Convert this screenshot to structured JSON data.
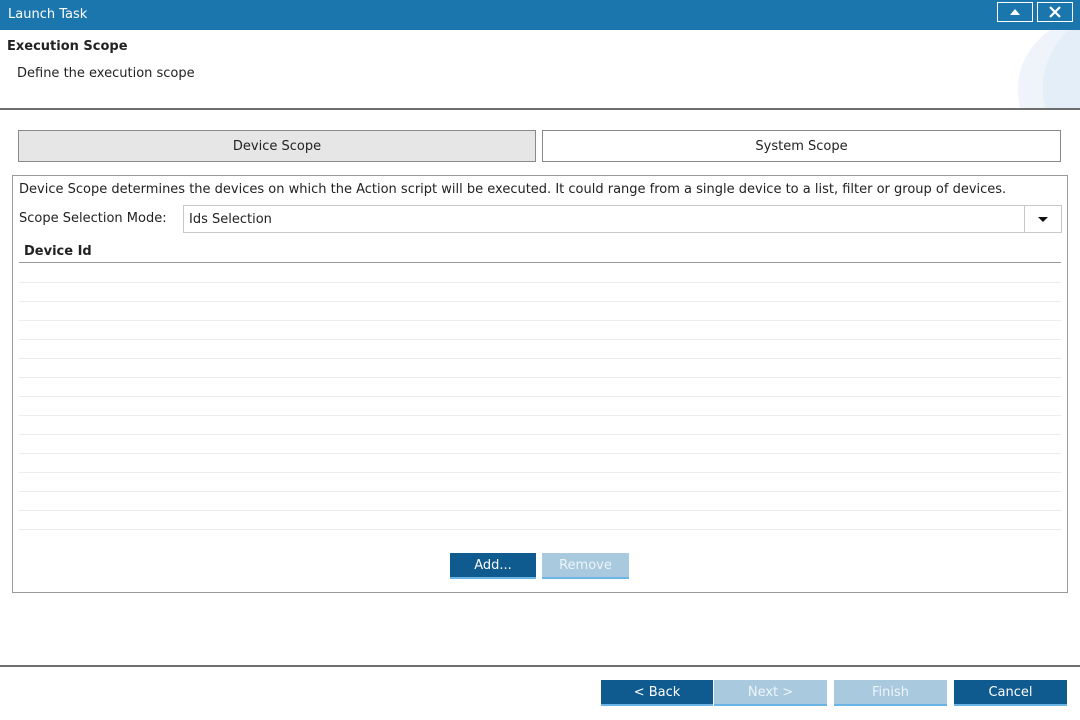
{
  "window": {
    "title": "Launch Task"
  },
  "header": {
    "title": "Execution Scope",
    "subtitle": "Define the execution scope"
  },
  "tabs": [
    {
      "label": "Device Scope",
      "selected": true
    },
    {
      "label": "System Scope",
      "selected": false
    }
  ],
  "panel": {
    "description": "Device Scope determines the devices on which the Action script will be executed. It could range from a single device to a list, filter or group of devices.",
    "mode_label": "Scope Selection Mode:",
    "mode_value": "Ids Selection"
  },
  "table": {
    "columns": [
      "Device Id"
    ],
    "rows": []
  },
  "table_actions": {
    "add_label": "Add...",
    "remove_label": "Remove"
  },
  "footer": {
    "back_label": "< Back",
    "next_label": "Next >",
    "finish_label": "Finish",
    "cancel_label": "Cancel"
  },
  "colors": {
    "titlebar": "#1c76ae",
    "primary_button": "#0f5a8f",
    "disabled_button": "#a9c9df",
    "button_underline": "#6bb5e6"
  }
}
